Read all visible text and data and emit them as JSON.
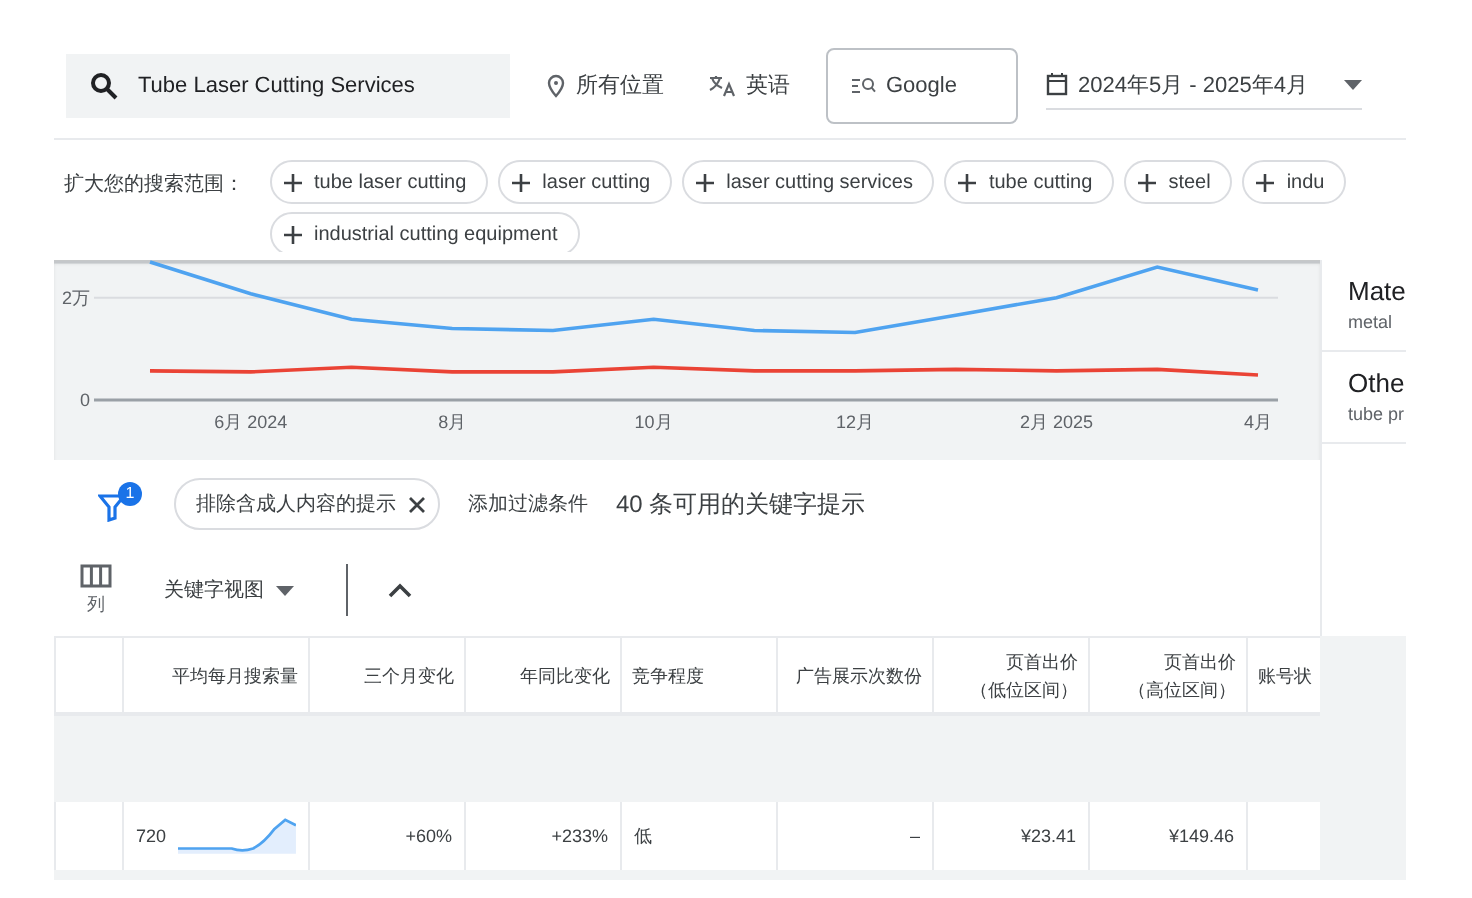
{
  "search": {
    "value": "Tube Laser Cutting Services"
  },
  "filters": [
    {
      "kind": "location",
      "label": "所有位置"
    },
    {
      "kind": "language",
      "label": "英语"
    },
    {
      "kind": "network",
      "label": "Google"
    }
  ],
  "date_range": {
    "label": "2024年5月 - 2025年4月"
  },
  "broaden": {
    "label": "扩大您的搜索范围：",
    "chips": [
      "tube laser cutting",
      "laser cutting",
      "laser cutting services",
      "tube cutting",
      "steel",
      "indu",
      "industrial cutting equipment"
    ]
  },
  "chart_data": {
    "type": "line",
    "categories": [
      null,
      "6月 2024",
      null,
      "8月",
      null,
      "10月",
      null,
      "12月",
      null,
      "2月 2025",
      null,
      "4月"
    ],
    "ylim": [
      0,
      2.7
    ],
    "yticks": [
      {
        "value": 0,
        "label": "0"
      },
      {
        "value": 2,
        "label": "2万"
      }
    ],
    "series": [
      {
        "color": "#4fa3f0",
        "values": [
          2.7,
          2.08,
          1.58,
          1.4,
          1.36,
          1.58,
          1.36,
          1.32,
          1.66,
          2.0,
          2.6,
          2.15
        ]
      },
      {
        "color": "#ea4335",
        "values": [
          0.57,
          0.55,
          0.64,
          0.55,
          0.55,
          0.64,
          0.57,
          0.57,
          0.6,
          0.57,
          0.6,
          0.49
        ]
      }
    ]
  },
  "side_panel": [
    {
      "title": "Mate",
      "subtitle": "metal"
    },
    {
      "title": "Othe",
      "subtitle": "tube pr"
    }
  ],
  "filter_bar": {
    "badge": "1",
    "chip": "排除含成人内容的提示",
    "add_filter": "添加过滤条件",
    "count": "40 条可用的关键字提示"
  },
  "toolbar": {
    "columns_label": "列",
    "view": "关键字视图"
  },
  "table": {
    "columns": [
      {},
      {
        "label": "平均每月搜索量"
      },
      {
        "label": "三个月变化"
      },
      {
        "label": "年同比变化"
      },
      {
        "label": "竞争程度"
      },
      {
        "label": "广告展示次数份"
      },
      {
        "label": "页首出价",
        "sub": "（低位区间）"
      },
      {
        "label": "页首出价",
        "sub": "（高位区间）"
      },
      {
        "label": "账号状"
      }
    ],
    "rows": [
      [
        "",
        "720",
        "+60%",
        "+233%",
        "低",
        "–",
        "¥23.41",
        "¥149.46",
        ""
      ]
    ]
  }
}
